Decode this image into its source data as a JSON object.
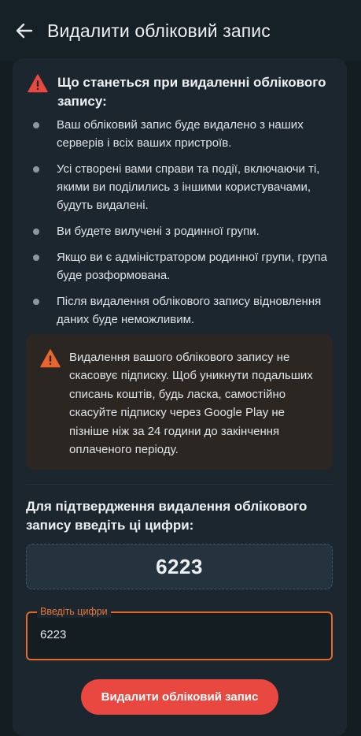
{
  "header": {
    "title": "Видалити обліковий запис",
    "back_icon": "arrow-left-icon"
  },
  "warning": {
    "title": "Що станеться при видаленні облікового запису:",
    "icon": "warning-triangle-icon",
    "icon_color": "#e8483f",
    "items": [
      "Ваш обліковий запис буде видалено з наших серверів і всіх ваших пристроїв.",
      "Усі створені вами справи та події, включаючи ті, якими ви поділились з іншими користувачами, будуть видалені.",
      "Ви будете вилучені з родинної групи.",
      "Якщо ви є адміністратором родинної групи, група буде розформована.",
      "Після видалення облікового запису відновлення даних буде неможливим."
    ]
  },
  "notice": {
    "icon": "warning-triangle-icon",
    "icon_color": "#e8662c",
    "text": "Видалення вашого облікового запису не скасовує підписку. Щоб уникнути подальших списань коштів, будь ласка, самостійно скасуйте підписку через Google Play не пізніше ніж за 24 години до закінчення оплаченого періоду."
  },
  "confirm": {
    "label": "Для підтвердження видалення облікового запису введіть ці цифри:",
    "code": "6223",
    "field_label": "Введіть цифри",
    "field_value": "6223"
  },
  "action": {
    "delete_label": "Видалити обліковий запис",
    "accent_color": "#e8483f"
  }
}
